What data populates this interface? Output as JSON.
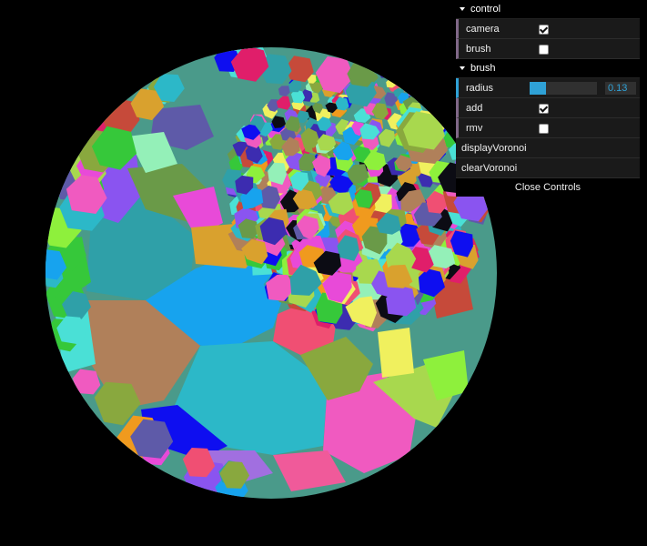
{
  "viewport": {
    "name": "voronoi-sphere",
    "background": "#000000",
    "cell_palette": [
      "#2fa0a8",
      "#17a3ee",
      "#b0805a",
      "#f04f73",
      "#f05ac0",
      "#8a54f0",
      "#2cb8c8",
      "#89a83e",
      "#0e0ef0",
      "#d9a12e",
      "#e84ad8",
      "#a8d84e",
      "#5e5aa8",
      "#94f0b8",
      "#f0f05e",
      "#36c83a",
      "#e01e6a",
      "#6a9a48",
      "#3c2cb0",
      "#f09a1e",
      "#8ef03c",
      "#c64a3a",
      "#4ae0d6",
      "#0c0c14"
    ]
  },
  "gui": {
    "control_folder": {
      "title": "control",
      "camera": {
        "label": "camera",
        "checked": true
      },
      "brush": {
        "label": "brush",
        "checked": false
      }
    },
    "brush_folder": {
      "title": "brush",
      "radius": {
        "label": "radius",
        "value": "0.13",
        "fraction": 0.24
      },
      "add": {
        "label": "add",
        "checked": true
      },
      "rmv": {
        "label": "rmv",
        "checked": false
      },
      "display": {
        "label": "displayVoronoi"
      },
      "clear": {
        "label": "clearVoronoi"
      }
    },
    "close_label": "Close Controls"
  }
}
